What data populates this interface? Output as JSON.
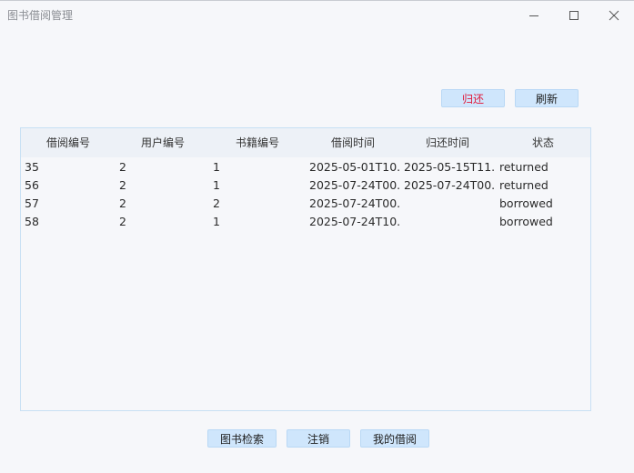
{
  "window": {
    "title": "图书借阅管理"
  },
  "toolbar": {
    "return_label": "归还",
    "refresh_label": "刷新"
  },
  "table": {
    "columns": [
      "借阅编号",
      "用户编号",
      "书籍编号",
      "借阅时间",
      "归还时间",
      "状态"
    ],
    "rows": [
      [
        "35",
        "2",
        "1",
        "2025-05-01T10...",
        "2025-05-15T11...",
        "returned"
      ],
      [
        "56",
        "2",
        "1",
        "2025-07-24T00...",
        "2025-07-24T00...",
        "returned"
      ],
      [
        "57",
        "2",
        "2",
        "2025-07-24T00...",
        "",
        "borrowed"
      ],
      [
        "58",
        "2",
        "1",
        "2025-07-24T10...",
        "",
        "borrowed"
      ]
    ]
  },
  "footer": {
    "search_label": "图书检索",
    "logout_label": "注销",
    "my_borrow_label": "我的借阅"
  },
  "icons": {
    "minimize": "minimize-icon",
    "maximize": "maximize-icon",
    "close": "close-icon"
  }
}
